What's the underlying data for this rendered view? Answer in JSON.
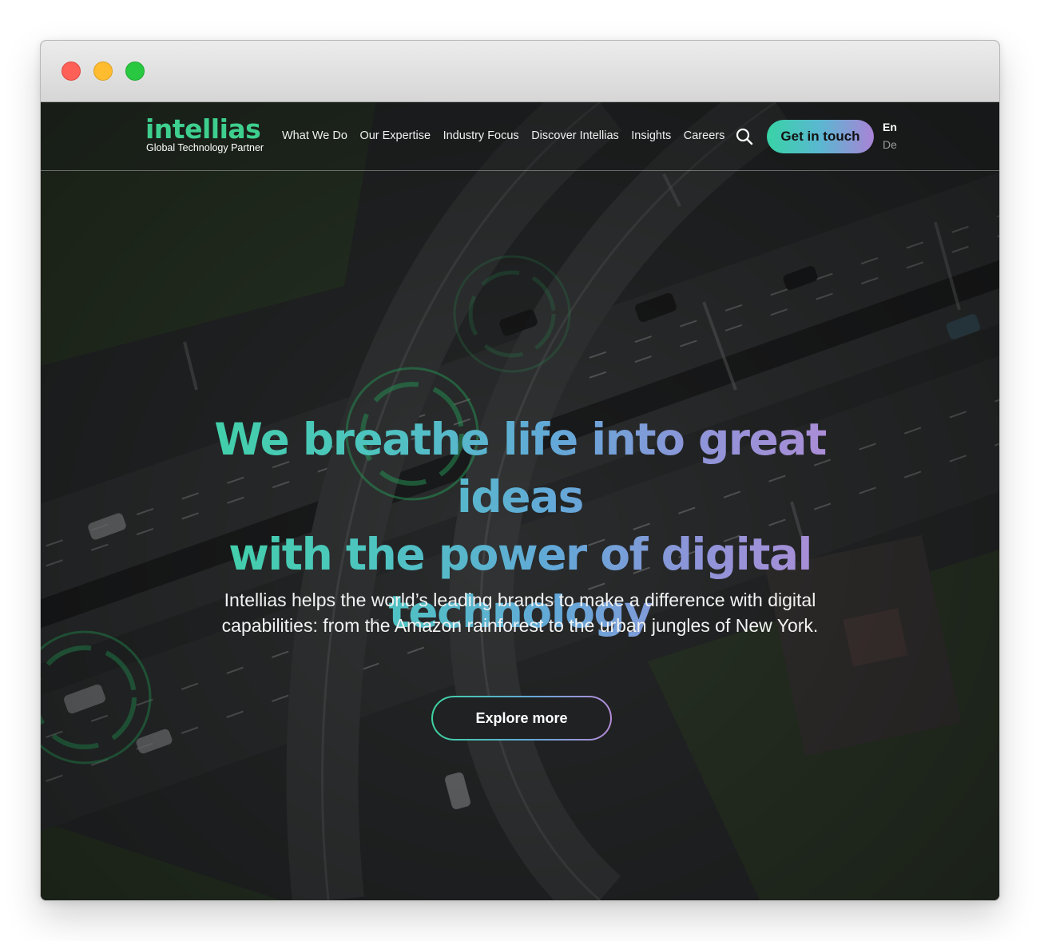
{
  "browser": {
    "window_controls": [
      "close",
      "minimize",
      "zoom"
    ]
  },
  "header": {
    "logo": {
      "wordmark": "intellias",
      "tagline": "Global Technology Partner"
    },
    "nav": [
      {
        "label": "What We Do"
      },
      {
        "label": "Our Expertise"
      },
      {
        "label": "Industry Focus"
      },
      {
        "label": "Discover Intellias"
      },
      {
        "label": "Insights"
      },
      {
        "label": "Careers"
      }
    ],
    "search_icon": "search-icon",
    "cta_label": "Get in touch",
    "languages": {
      "active": "En",
      "other": "De"
    }
  },
  "hero": {
    "title_line1": "We breathe life into great ideas",
    "title_line2": "with the power of digital",
    "title_line3": "technology",
    "subtitle_line1": "Intellias helps the world’s leading brands to make a difference with digital",
    "subtitle_line2": "capabilities: from the Amazon rainforest to the urban jungles of New York.",
    "button_label": "Explore more"
  },
  "colors": {
    "brand_green": "#3ecf8e",
    "gradient_start": "#3ed3a2",
    "gradient_mid": "#63a8d8",
    "gradient_end": "#b68bd6",
    "background": "#2a2c2d"
  }
}
